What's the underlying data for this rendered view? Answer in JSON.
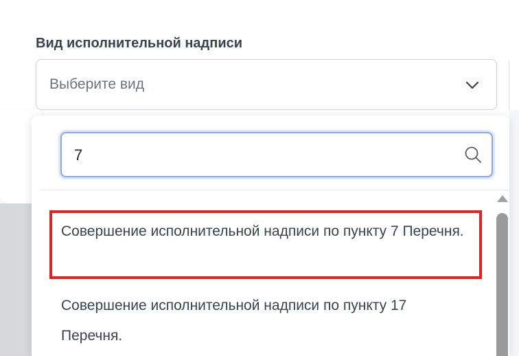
{
  "field": {
    "label": "Вид исполнительной надписи",
    "placeholder": "Выберите вид"
  },
  "search": {
    "value": "7"
  },
  "options": [
    {
      "label": "Совершение исполнительной надписи по пункту 7 Перечня.",
      "highlighted": true
    },
    {
      "label": "Совершение исполнительной надписи по пункту 17 Перечня.",
      "highlighted": false
    }
  ],
  "icons": {
    "select": "chevron-down-icon",
    "search": "search-icon",
    "scroll": "scroll-up-arrow-icon"
  },
  "colors": {
    "highlight_border": "#e4211c",
    "focus_border": "#8da4ef",
    "scroll_thumb": "#9a9a9a"
  }
}
